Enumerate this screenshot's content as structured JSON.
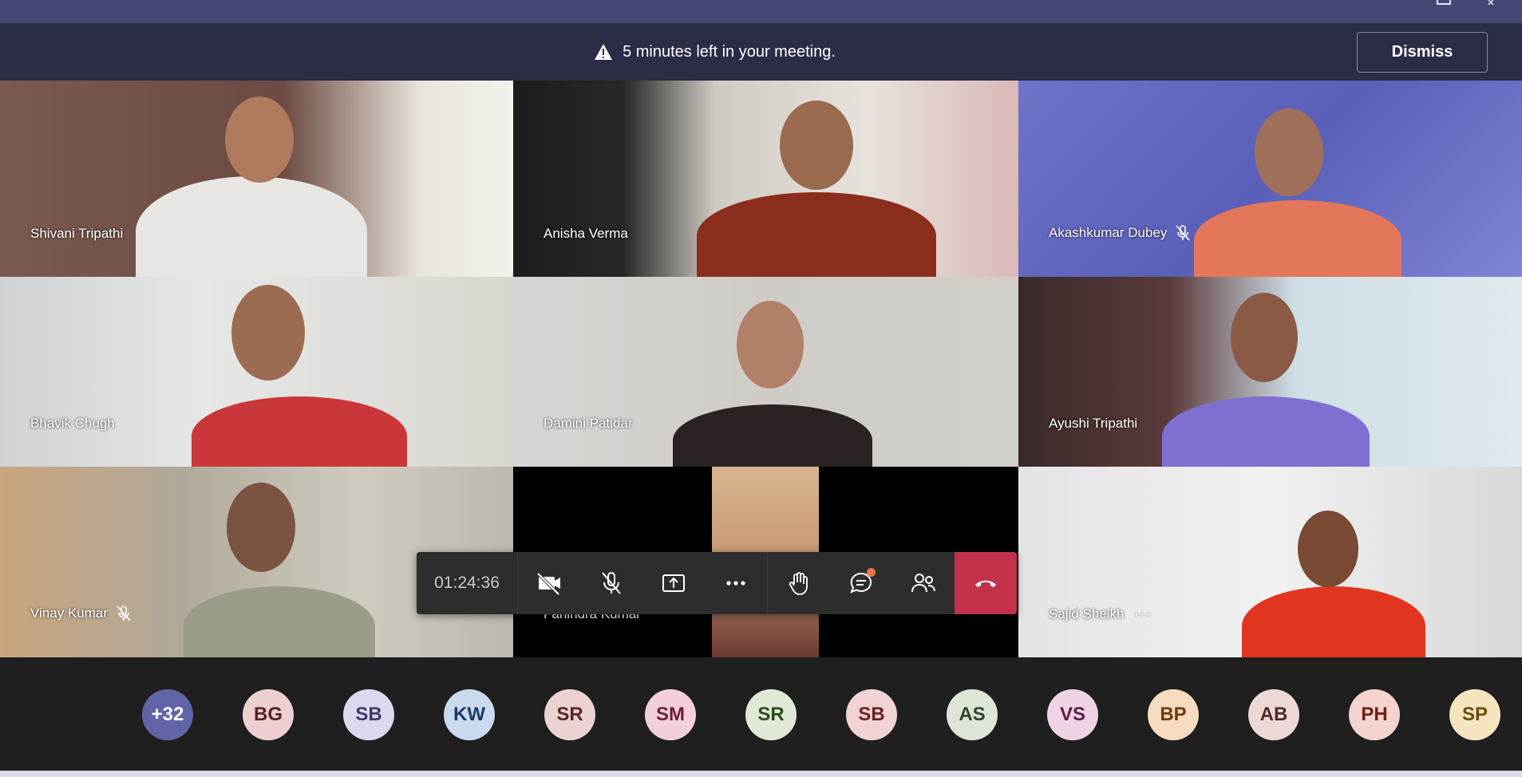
{
  "banner": {
    "message": "5 minutes left in your meeting.",
    "dismiss_label": "Dismiss",
    "icon": "warning-icon"
  },
  "participants": [
    {
      "name": "Shivani Tripathi",
      "muted": false
    },
    {
      "name": "Anisha Verma",
      "muted": false
    },
    {
      "name": "Akashkumar Dubey",
      "muted": true
    },
    {
      "name": "Bhavik Chugh",
      "muted": false
    },
    {
      "name": "Damini Patidar",
      "muted": false
    },
    {
      "name": "Ayushi Tripathi",
      "muted": false
    },
    {
      "name": "Vinay Kumar",
      "muted": true
    },
    {
      "name": "Fanindra Kumar",
      "muted": false
    },
    {
      "name": "Sajid Sheikh",
      "muted": false
    }
  ],
  "controls": {
    "timer": "01:24:36",
    "buttons": [
      "camera-off-icon",
      "mic-off-icon",
      "share-screen-icon",
      "more-options-icon",
      "raise-hand-icon",
      "chat-icon",
      "participants-icon",
      "hang-up-icon"
    ],
    "chat_has_notification": true
  },
  "avatars": [
    {
      "initials": "+32",
      "bg": "#6264a7",
      "fg": "#ffffff"
    },
    {
      "initials": "BG",
      "bg": "#edcfd2",
      "fg": "#5a1f26"
    },
    {
      "initials": "SB",
      "bg": "#dcd9ee",
      "fg": "#3f3b6b"
    },
    {
      "initials": "KW",
      "bg": "#c9d9ee",
      "fg": "#1e3a66"
    },
    {
      "initials": "SR",
      "bg": "#ead2d3",
      "fg": "#5a2428"
    },
    {
      "initials": "SM",
      "bg": "#f3cfdc",
      "fg": "#6b1f3a"
    },
    {
      "initials": "SR",
      "bg": "#dfe9d6",
      "fg": "#2f4a22"
    },
    {
      "initials": "SB",
      "bg": "#f1d3d5",
      "fg": "#6b2228"
    },
    {
      "initials": "AS",
      "bg": "#dde6d6",
      "fg": "#2f4528"
    },
    {
      "initials": "VS",
      "bg": "#efd3e4",
      "fg": "#5d1f45"
    },
    {
      "initials": "BP",
      "bg": "#f7dcc0",
      "fg": "#6b3e10"
    },
    {
      "initials": "AB",
      "bg": "#ecd8d6",
      "fg": "#4f2a27"
    },
    {
      "initials": "PH",
      "bg": "#f5d3cf",
      "fg": "#6b2318"
    },
    {
      "initials": "SP",
      "bg": "#f6e3c0",
      "fg": "#6b4d10"
    }
  ],
  "colors": {
    "title_bar": "#464775",
    "banner": "#2b2c45",
    "hang_up": "#c4314b",
    "notification": "#e97548"
  }
}
